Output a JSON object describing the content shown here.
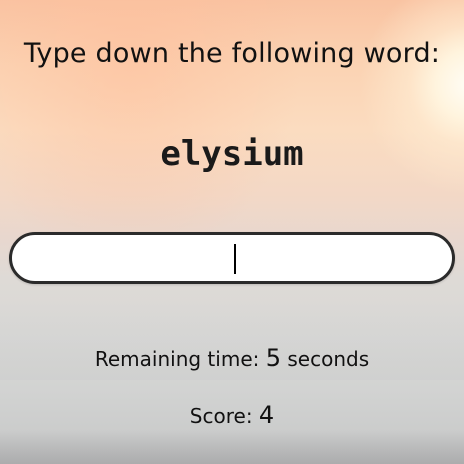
{
  "prompt": {
    "instruction": "Type down the following word:",
    "word": "elysium"
  },
  "answer_input": {
    "value": "",
    "placeholder": ""
  },
  "timer": {
    "label": "Remaining time:",
    "value": "5",
    "unit": "seconds"
  },
  "score": {
    "label": "Score:",
    "value": "4"
  },
  "colors": {
    "text": "#111111",
    "input_border": "#2b2b2b",
    "input_background": "#ffffff",
    "sky_top": "#f9c3a2",
    "sea": "#d2d3d2"
  }
}
